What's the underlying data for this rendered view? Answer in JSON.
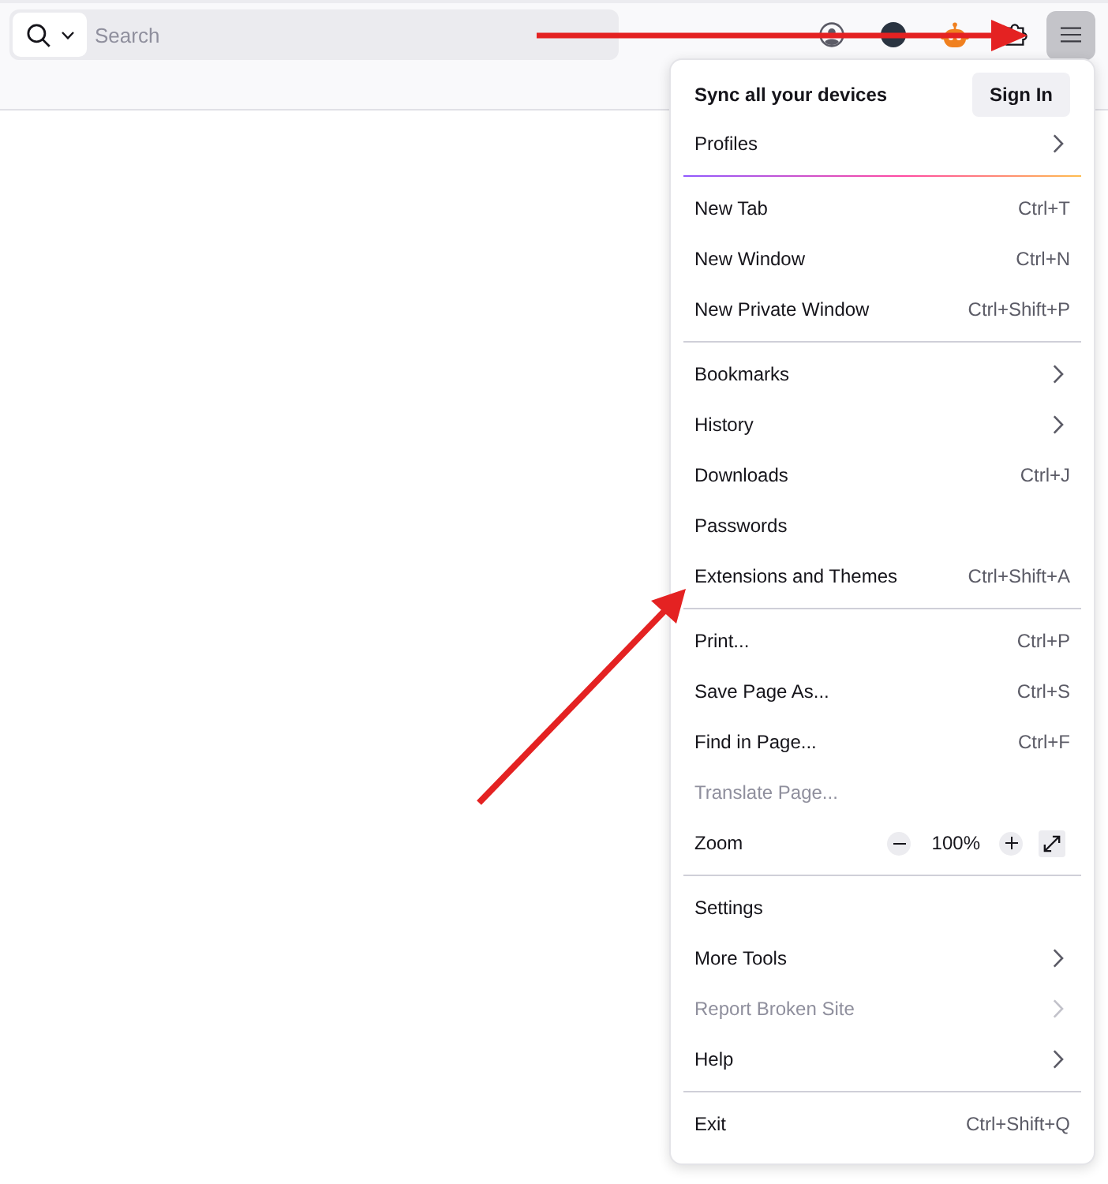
{
  "toolbar": {
    "search": {
      "placeholder": "Search"
    },
    "menu_button": {
      "open": true
    }
  },
  "menu": {
    "account": {
      "title": "Sync all your devices",
      "button": "Sign In"
    },
    "items": [
      {
        "kind": "item",
        "label": "Profiles",
        "submenu": true,
        "disabled": false
      },
      {
        "kind": "separator"
      },
      {
        "kind": "item",
        "label": "New Tab",
        "shortcut": "Ctrl+T",
        "submenu": false,
        "disabled": false
      },
      {
        "kind": "item",
        "label": "New Window",
        "shortcut": "Ctrl+N",
        "submenu": false,
        "disabled": false
      },
      {
        "kind": "item",
        "label": "New Private Window",
        "shortcut": "Ctrl+Shift+P",
        "submenu": false,
        "disabled": false
      },
      {
        "kind": "separator"
      },
      {
        "kind": "item",
        "label": "Bookmarks",
        "submenu": true,
        "disabled": false
      },
      {
        "kind": "item",
        "label": "History",
        "submenu": true,
        "disabled": false
      },
      {
        "kind": "item",
        "label": "Downloads",
        "shortcut": "Ctrl+J",
        "submenu": false,
        "disabled": false
      },
      {
        "kind": "item",
        "label": "Passwords",
        "submenu": false,
        "disabled": false
      },
      {
        "kind": "item",
        "label": "Extensions and Themes",
        "shortcut": "Ctrl+Shift+A",
        "submenu": false,
        "disabled": false
      },
      {
        "kind": "separator"
      },
      {
        "kind": "item",
        "label": "Print...",
        "shortcut": "Ctrl+P",
        "submenu": false,
        "disabled": false
      },
      {
        "kind": "item",
        "label": "Save Page As...",
        "shortcut": "Ctrl+S",
        "submenu": false,
        "disabled": false
      },
      {
        "kind": "item",
        "label": "Find in Page...",
        "shortcut": "Ctrl+F",
        "submenu": false,
        "disabled": false
      },
      {
        "kind": "item",
        "label": "Translate Page...",
        "submenu": false,
        "disabled": true
      },
      {
        "kind": "zoom",
        "label": "Zoom",
        "value": "100%"
      },
      {
        "kind": "separator"
      },
      {
        "kind": "item",
        "label": "Settings",
        "submenu": false,
        "disabled": false
      },
      {
        "kind": "item",
        "label": "More Tools",
        "submenu": true,
        "disabled": false
      },
      {
        "kind": "item",
        "label": "Report Broken Site",
        "submenu": true,
        "disabled": true
      },
      {
        "kind": "item",
        "label": "Help",
        "submenu": true,
        "disabled": false
      },
      {
        "kind": "separator"
      },
      {
        "kind": "item",
        "label": "Exit",
        "shortcut": "Ctrl+Shift+Q",
        "submenu": false,
        "disabled": false
      }
    ]
  }
}
